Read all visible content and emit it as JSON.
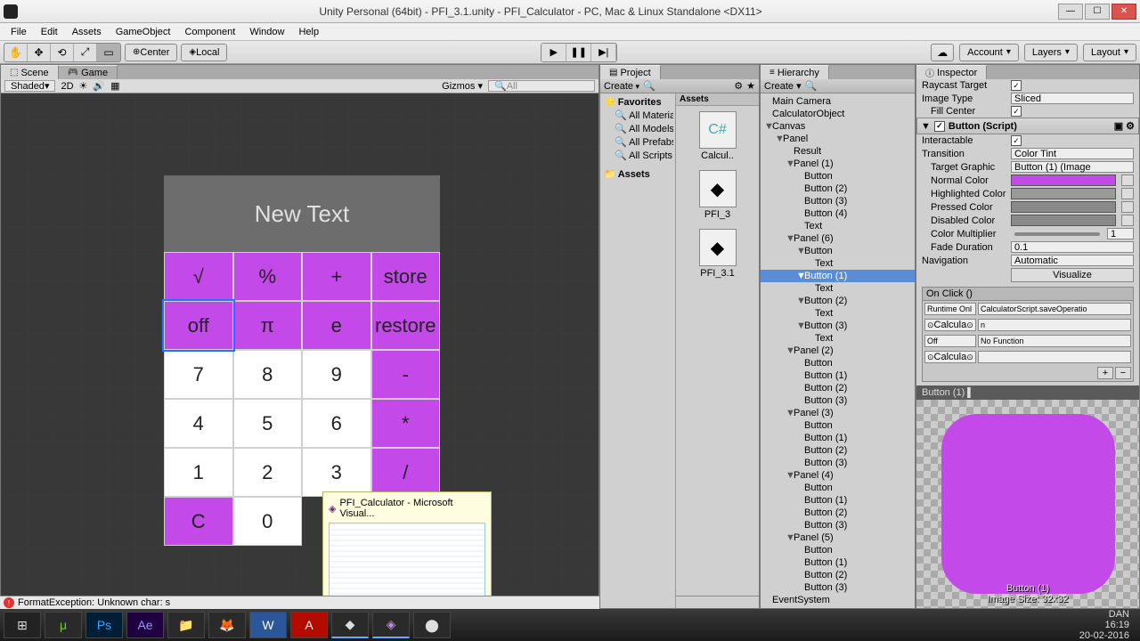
{
  "window": {
    "title": "Unity Personal (64bit) - PFI_3.1.unity - PFI_Calculator - PC, Mac & Linux Standalone <DX11>"
  },
  "menu": [
    "File",
    "Edit",
    "Assets",
    "GameObject",
    "Component",
    "Window",
    "Help"
  ],
  "toolbar": {
    "center_label": "Center",
    "local_label": "Local",
    "account": "Account",
    "layers": "Layers",
    "layout": "Layout"
  },
  "scene_panel": {
    "tab_scene": "Scene",
    "tab_game": "Game",
    "shaded": "Shaded",
    "mode_2d": "2D",
    "gizmos": "Gizmos",
    "search_placeholder": "All"
  },
  "calculator": {
    "display": "New Text",
    "rows": [
      [
        {
          "t": "√",
          "c": "p"
        },
        {
          "t": "%",
          "c": "p"
        },
        {
          "t": "+",
          "c": "p"
        },
        {
          "t": "store",
          "c": "p"
        }
      ],
      [
        {
          "t": "off",
          "c": "p",
          "sel": true
        },
        {
          "t": "π",
          "c": "p"
        },
        {
          "t": "e",
          "c": "p"
        },
        {
          "t": "restore",
          "c": "p"
        }
      ],
      [
        {
          "t": "7",
          "c": "w"
        },
        {
          "t": "8",
          "c": "w"
        },
        {
          "t": "9",
          "c": "w"
        },
        {
          "t": "-",
          "c": "p"
        }
      ],
      [
        {
          "t": "4",
          "c": "w"
        },
        {
          "t": "5",
          "c": "w"
        },
        {
          "t": "6",
          "c": "w"
        },
        {
          "t": "*",
          "c": "p"
        }
      ],
      [
        {
          "t": "1",
          "c": "w"
        },
        {
          "t": "2",
          "c": "w"
        },
        {
          "t": "3",
          "c": "w"
        },
        {
          "t": "/",
          "c": "p"
        }
      ],
      [
        {
          "t": "C",
          "c": "p"
        },
        {
          "t": "0",
          "c": "w"
        },
        {
          "t": "",
          "c": "w"
        },
        {
          "t": "",
          "c": "w"
        }
      ]
    ]
  },
  "project": {
    "tab": "Project",
    "create": "Create",
    "favorites": "Favorites",
    "fav_items": [
      "All Materia",
      "All Models",
      "All Prefabs",
      "All Scripts"
    ],
    "assets": "Assets",
    "assets_hdr": "Assets",
    "icons": [
      {
        "label": "Calcul..",
        "type": "csharp"
      },
      {
        "label": "PFI_3",
        "type": "unity"
      },
      {
        "label": "PFI_3.1",
        "type": "unity"
      }
    ]
  },
  "hierarchy": {
    "tab": "Hierarchy",
    "create": "Create",
    "items": [
      {
        "t": "Main Camera",
        "d": 0
      },
      {
        "t": "CalculatorObject",
        "d": 0
      },
      {
        "t": "Canvas",
        "d": 0,
        "exp": true
      },
      {
        "t": "Panel",
        "d": 1,
        "exp": true
      },
      {
        "t": "Result",
        "d": 2
      },
      {
        "t": "Panel (1)",
        "d": 2,
        "exp": true
      },
      {
        "t": "Button",
        "d": 3
      },
      {
        "t": "Button (2)",
        "d": 3
      },
      {
        "t": "Button (3)",
        "d": 3
      },
      {
        "t": "Button (4)",
        "d": 3
      },
      {
        "t": "Text",
        "d": 3
      },
      {
        "t": "Panel (6)",
        "d": 2,
        "exp": true
      },
      {
        "t": "Button",
        "d": 3,
        "exp": true
      },
      {
        "t": "Text",
        "d": 4
      },
      {
        "t": "Button (1)",
        "d": 3,
        "exp": true,
        "sel": true
      },
      {
        "t": "Text",
        "d": 4
      },
      {
        "t": "Button (2)",
        "d": 3,
        "exp": true
      },
      {
        "t": "Text",
        "d": 4
      },
      {
        "t": "Button (3)",
        "d": 3,
        "exp": true
      },
      {
        "t": "Text",
        "d": 4
      },
      {
        "t": "Panel (2)",
        "d": 2,
        "exp": true
      },
      {
        "t": "Button",
        "d": 3
      },
      {
        "t": "Button (1)",
        "d": 3
      },
      {
        "t": "Button (2)",
        "d": 3
      },
      {
        "t": "Button (3)",
        "d": 3
      },
      {
        "t": "Panel (3)",
        "d": 2,
        "exp": true
      },
      {
        "t": "Button",
        "d": 3
      },
      {
        "t": "Button (1)",
        "d": 3
      },
      {
        "t": "Button (2)",
        "d": 3
      },
      {
        "t": "Button (3)",
        "d": 3
      },
      {
        "t": "Panel (4)",
        "d": 2,
        "exp": true
      },
      {
        "t": "Button",
        "d": 3
      },
      {
        "t": "Button (1)",
        "d": 3
      },
      {
        "t": "Button (2)",
        "d": 3
      },
      {
        "t": "Button (3)",
        "d": 3
      },
      {
        "t": "Panel (5)",
        "d": 2,
        "exp": true
      },
      {
        "t": "Button",
        "d": 3
      },
      {
        "t": "Button (1)",
        "d": 3
      },
      {
        "t": "Button (2)",
        "d": 3
      },
      {
        "t": "Button (3)",
        "d": 3
      },
      {
        "t": "EventSystem",
        "d": 0
      }
    ]
  },
  "inspector": {
    "tab": "Inspector",
    "raycast_target": "Raycast Target",
    "image_type": "Image Type",
    "image_type_val": "Sliced",
    "fill_center": "Fill Center",
    "button_script": "Button (Script)",
    "interactable": "Interactable",
    "transition": "Transition",
    "transition_val": "Color Tint",
    "target_graphic": "Target Graphic",
    "target_graphic_val": "Button (1) (Image",
    "normal_color": "Normal Color",
    "normal_color_val": "#c349e8",
    "highlighted_color": "Highlighted Color",
    "highlighted_color_val": "#9a9a9a",
    "pressed_color": "Pressed Color",
    "pressed_color_val": "#8a8a8a",
    "disabled_color": "Disabled Color",
    "disabled_color_val": "#8a8a8a",
    "color_multiplier": "Color Multiplier",
    "color_multiplier_val": "1",
    "fade_duration": "Fade Duration",
    "fade_duration_val": "0.1",
    "navigation": "Navigation",
    "navigation_val": "Automatic",
    "visualize": "Visualize",
    "onclick": "On Click ()",
    "runtime_only": "Runtime Onl",
    "func1": "CalculatorScript.saveOperatio",
    "obj1": "Calcula",
    "arg1": "n",
    "off": "Off",
    "nofunc": "No Function",
    "obj2": "Calcula",
    "preview_name": "Button (1)",
    "preview_size": "Image Size: 32x32"
  },
  "vs_preview": {
    "title": "PFI_Calculator - Microsoft Visual..."
  },
  "error": "FormatException: Unknown char: s",
  "clock": {
    "time": "16:19",
    "date": "20-02-2016",
    "lang": "DAN"
  }
}
